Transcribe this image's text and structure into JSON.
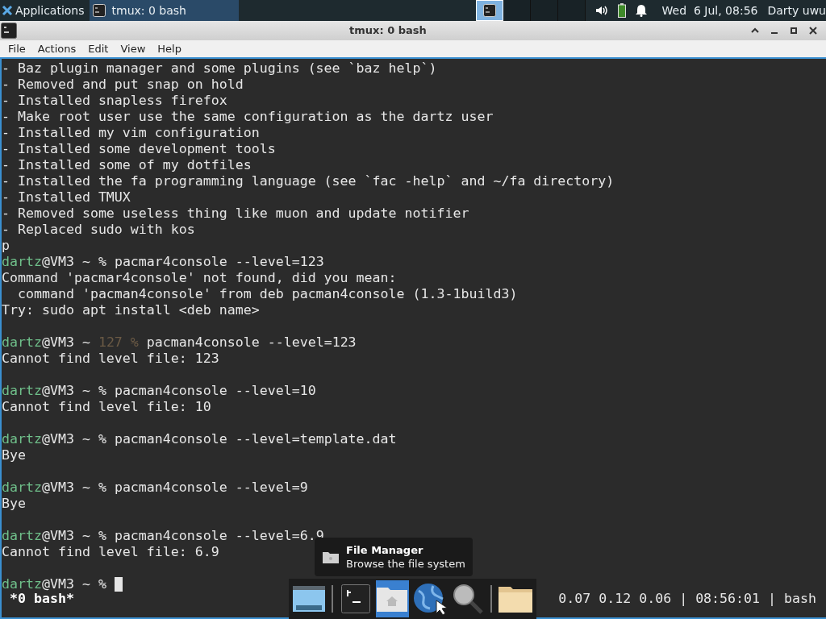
{
  "panel": {
    "apps_menu": "Applications",
    "tasks": [
      {
        "label": "tmux: 0 bash",
        "selected": true
      }
    ],
    "workspaces": [
      {
        "selected": true
      },
      {
        "selected": false
      },
      {
        "selected": false
      },
      {
        "selected": false
      }
    ],
    "clock": "Wed  6 Jul, 08:56",
    "user": "Darty uwu"
  },
  "window": {
    "title": "tmux: 0 bash"
  },
  "menu": [
    "File",
    "Actions",
    "Edit",
    "View",
    "Help"
  ],
  "terminal": {
    "lines": [
      {
        "kind": "output",
        "text": "- Baz plugin manager and some plugins (see `baz help`)"
      },
      {
        "kind": "output",
        "text": "- Removed and put snap on hold"
      },
      {
        "kind": "output",
        "text": "- Installed snapless firefox"
      },
      {
        "kind": "output",
        "text": "- Make root user use the same configuration as the dartz user"
      },
      {
        "kind": "output",
        "text": "- Installed my vim configuration"
      },
      {
        "kind": "output",
        "text": "- Installed some development tools"
      },
      {
        "kind": "output",
        "text": "- Installed some of my dotfiles"
      },
      {
        "kind": "output",
        "text": "- Installed the fa programming language (see `fac -help` and ~/fa directory)"
      },
      {
        "kind": "output",
        "text": "- Installed TMUX"
      },
      {
        "kind": "output",
        "text": "- Removed some useless thing like muon and update notifier"
      },
      {
        "kind": "output",
        "text": "- Replaced sudo with kos"
      },
      {
        "kind": "output",
        "text": "p"
      },
      {
        "kind": "prompt",
        "user": "dartz",
        "host": "@VM3 ~",
        "symbol": "%",
        "command": "pacmar4console --level=123"
      },
      {
        "kind": "output",
        "text": "Command 'pacmar4console' not found, did you mean:"
      },
      {
        "kind": "output",
        "text": "  command 'pacman4console' from deb pacman4console (1.3-1build3)"
      },
      {
        "kind": "output",
        "text": "Try: sudo apt install <deb name>"
      },
      {
        "kind": "blank"
      },
      {
        "kind": "prompt",
        "user": "dartz",
        "host": "@VM3 ~",
        "status": "127",
        "symbol": "%",
        "command": "pacman4console --level=123"
      },
      {
        "kind": "output",
        "text": "Cannot find level file: 123"
      },
      {
        "kind": "blank"
      },
      {
        "kind": "prompt",
        "user": "dartz",
        "host": "@VM3 ~",
        "symbol": "%",
        "command": "pacman4console --level=10"
      },
      {
        "kind": "output",
        "text": "Cannot find level file: 10"
      },
      {
        "kind": "blank"
      },
      {
        "kind": "prompt",
        "user": "dartz",
        "host": "@VM3 ~",
        "symbol": "%",
        "command": "pacman4console --level=template.dat"
      },
      {
        "kind": "output",
        "text": "Bye"
      },
      {
        "kind": "blank"
      },
      {
        "kind": "prompt",
        "user": "dartz",
        "host": "@VM3 ~",
        "symbol": "%",
        "command": "pacman4console --level=9"
      },
      {
        "kind": "output",
        "text": "Bye"
      },
      {
        "kind": "blank"
      },
      {
        "kind": "prompt",
        "user": "dartz",
        "host": "@VM3 ~",
        "symbol": "%",
        "command": "pacman4console --level=6.9"
      },
      {
        "kind": "output",
        "text": "Cannot find level file: 6.9"
      },
      {
        "kind": "blank"
      },
      {
        "kind": "prompt",
        "user": "dartz",
        "host": "@VM3 ~",
        "symbol": "%",
        "cursor": true
      }
    ],
    "status_left": "*0 bash*",
    "status_right": "0.07 0.12 0.06 | 08:56:01 | bash"
  },
  "tooltip": {
    "title": "File Manager",
    "subtitle": "Browse the file system"
  },
  "dock": [
    {
      "kind": "desktop"
    },
    {
      "kind": "separator"
    },
    {
      "kind": "terminal"
    },
    {
      "kind": "home",
      "selected": true
    },
    {
      "kind": "globe"
    },
    {
      "kind": "search"
    },
    {
      "kind": "separator"
    },
    {
      "kind": "folder"
    }
  ]
}
